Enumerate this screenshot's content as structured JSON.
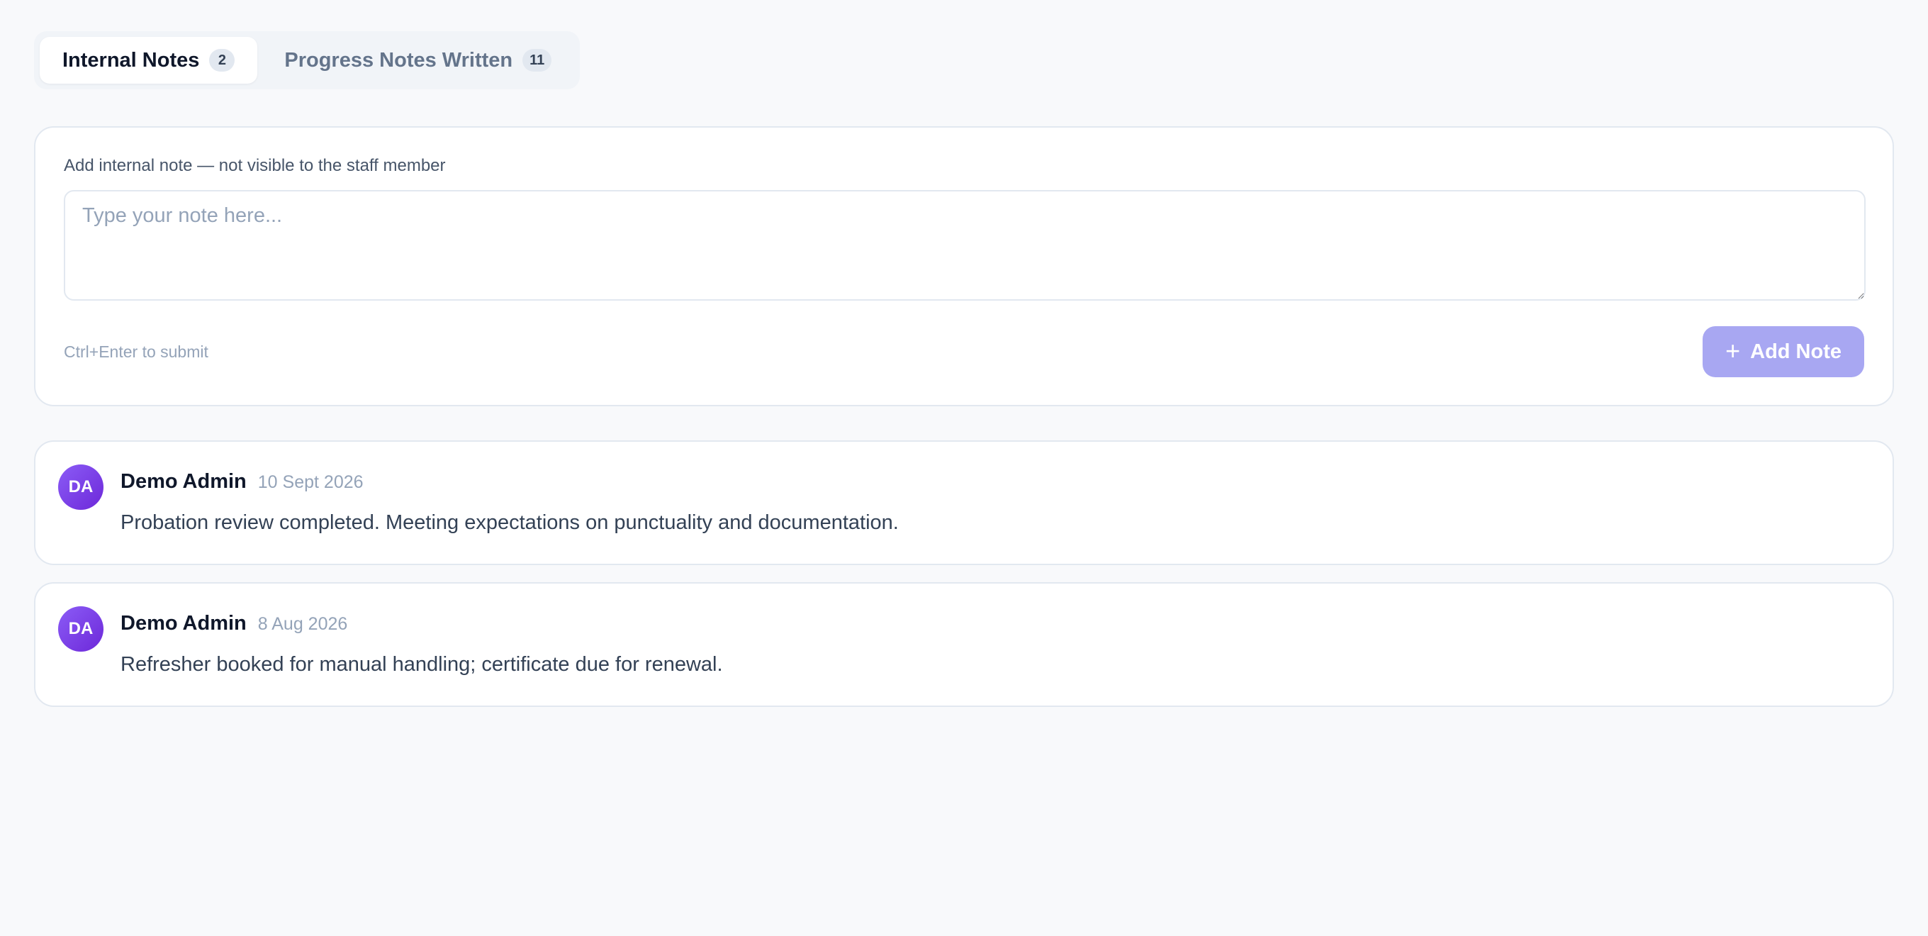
{
  "tabs": [
    {
      "label": "Internal Notes",
      "count": "2"
    },
    {
      "label": "Progress Notes Written",
      "count": "11"
    }
  ],
  "composer": {
    "label": "Add internal note — not visible to the staff member",
    "placeholder": "Type your note here...",
    "hint": "Ctrl+Enter to submit",
    "button_label": "Add Note",
    "button_icon": "plus-icon"
  },
  "notes": [
    {
      "initials": "DA",
      "author": "Demo Admin",
      "date": "10 Sept 2026",
      "text": "Probation review completed. Meeting expectations on punctuality and documentation."
    },
    {
      "initials": "DA",
      "author": "Demo Admin",
      "date": "8 Aug 2026",
      "text": "Refresher booked for manual handling; certificate due for renewal."
    }
  ],
  "colors": {
    "accent_button": "#a8a7f2",
    "avatar": "#7c3aed",
    "background": "#f8f9fb"
  }
}
